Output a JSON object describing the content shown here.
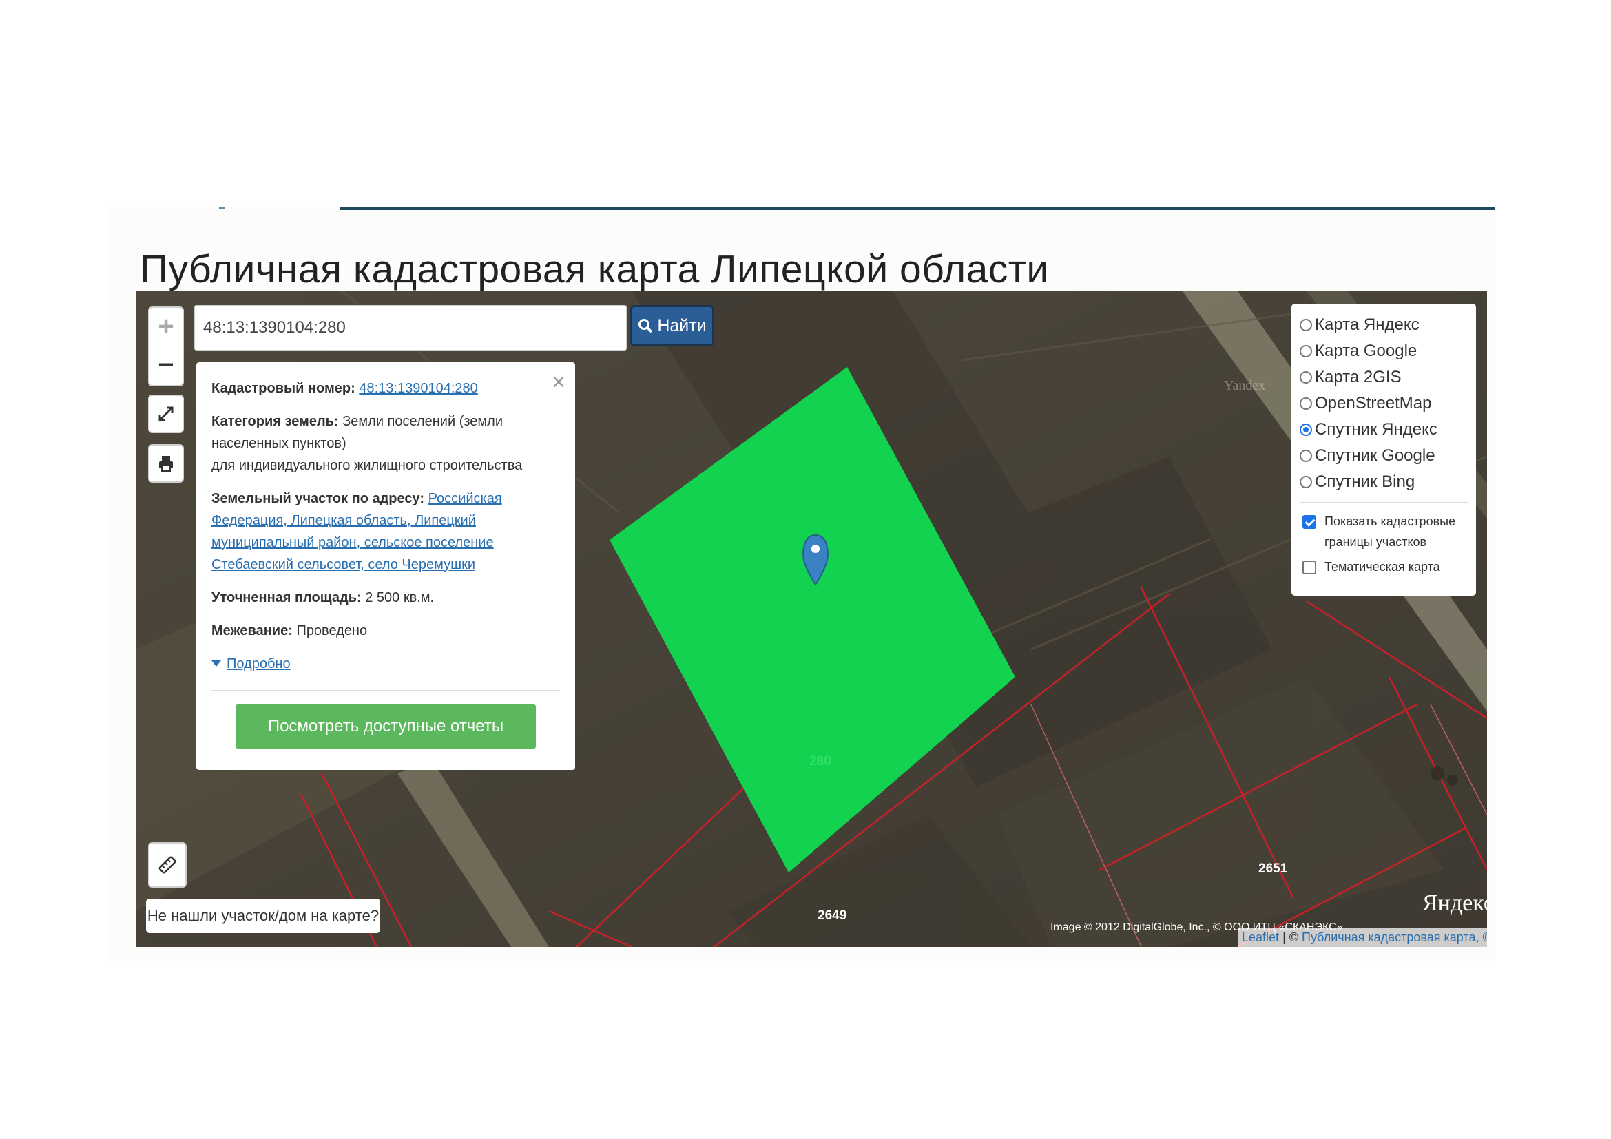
{
  "page": {
    "title": "Публичная кадастровая карта Липецкой области"
  },
  "map_controls": {
    "zoom_in": "+",
    "zoom_out": "−"
  },
  "search": {
    "value": "48:13:1390104:280",
    "button_label": "Найти"
  },
  "popup": {
    "cadastral_label": "Кадастровый номер:",
    "cadastral_value": "48:13:1390104:280",
    "category_label": "Категория земель:",
    "category_value": "Земли поселений (земли населенных пунктов)",
    "permitted_use": "для индивидуального жилищного строительства",
    "address_label": "Земельный участок по адресу:",
    "address_value": "Российская Федерация, Липецкая область, Липецкий муниципальный район, сельское поселение Стебаевский сельсовет, село Черемушки",
    "area_label": "Уточненная площадь:",
    "area_value": "2 500 кв.м.",
    "survey_label": "Межевание:",
    "survey_value": "Проведено",
    "more_link": "Подробно",
    "reports_button": "Посмотреть доступные отчеты"
  },
  "layers": {
    "options": [
      {
        "label": "Карта Яндекс",
        "selected": false
      },
      {
        "label": "Карта Google",
        "selected": false
      },
      {
        "label": "Карта 2GIS",
        "selected": false
      },
      {
        "label": "OpenStreetMap",
        "selected": false
      },
      {
        "label": "Спутник Яндекс",
        "selected": true
      },
      {
        "label": "Спутник Google",
        "selected": false
      },
      {
        "label": "Спутник Bing",
        "selected": false
      }
    ],
    "show_boundaries": {
      "label": "Показать кадастровые границы участков",
      "checked": true
    },
    "thematic": {
      "label": "Тематическая карта",
      "checked": false
    }
  },
  "not_found": "Не нашли участок/дом на карте?",
  "parcel_labels": {
    "main": "280",
    "a": "2651",
    "b": "2649"
  },
  "watermark": "Yandex",
  "yandex_logo": "Яндекс",
  "attribution": {
    "imagery": "Image © 2012 DigitalGlobe, Inc., © ООО ИТЦ «СКАНЭКС»",
    "leaflet": "Leaflet",
    "source": "Публичная кадастровая карта, ©"
  },
  "colors": {
    "parcel": "#12d24f",
    "accent": "#2b5d96",
    "report_button": "#5cb85c",
    "boundary": "#c8202a"
  }
}
